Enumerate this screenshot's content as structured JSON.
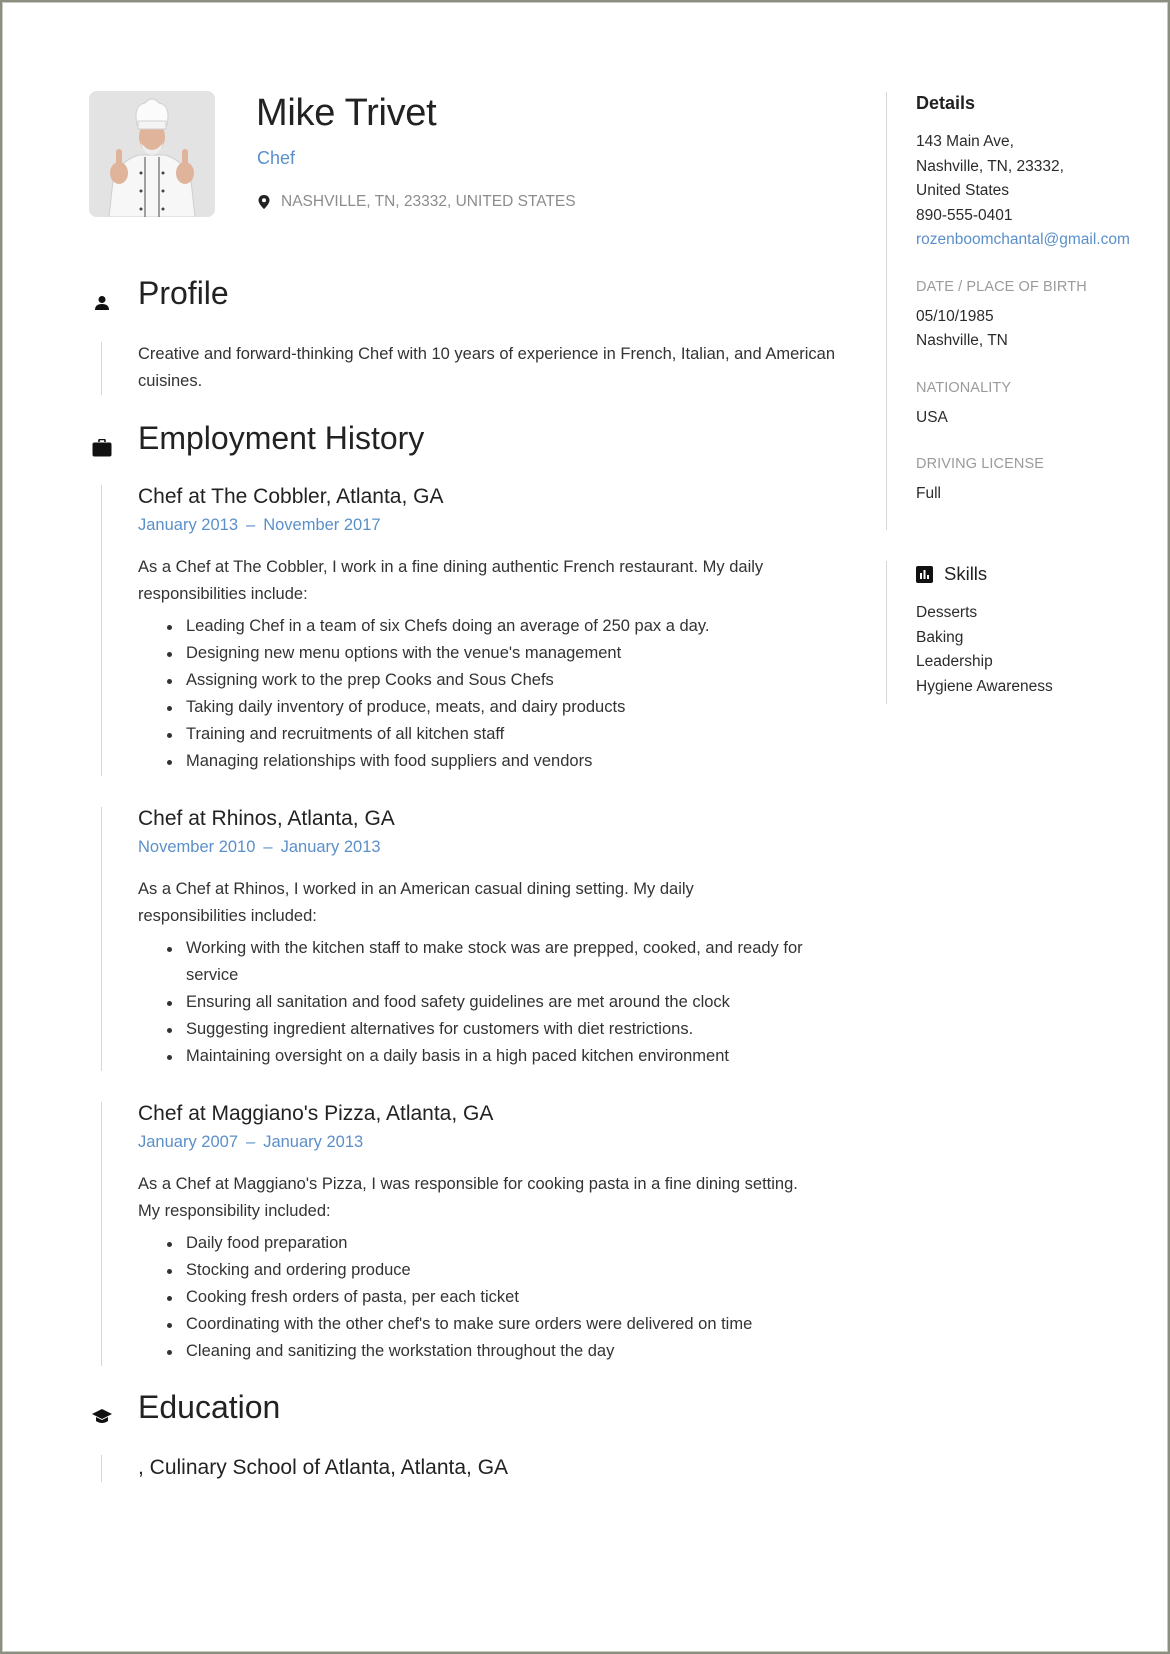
{
  "header": {
    "name": "Mike Trivet",
    "job_title": "Chef",
    "location": "NASHVILLE, TN, 23332, UNITED STATES",
    "photo_alt": "Chef portrait giving thumbs up"
  },
  "profile": {
    "heading": "Profile",
    "icon": "person-icon",
    "text": "Creative and forward-thinking Chef with 10 years of experience in French, Italian, and American cuisines."
  },
  "employment": {
    "heading": "Employment History",
    "icon": "briefcase-icon",
    "jobs": [
      {
        "title": "Chef at The Cobbler, Atlanta, GA",
        "start": "January 2013",
        "end": "November 2017",
        "dash": "–",
        "description": "As a Chef at The Cobbler, I work in a fine dining authentic French restaurant. My daily responsibilities include:",
        "bullets": [
          "Leading Chef in a team of six Chefs doing an average of 250 pax a day.",
          "Designing new menu options with the venue's management",
          "Assigning work to the prep Cooks and Sous Chefs",
          "Taking daily inventory of produce, meats, and dairy products",
          "Training and recruitments of all kitchen staff",
          "Managing relationships with food suppliers and vendors"
        ]
      },
      {
        "title": "Chef at Rhinos, Atlanta, GA",
        "start": "November 2010",
        "end": "January 2013",
        "dash": "–",
        "description": "As a Chef at Rhinos, I worked in an American casual dining setting. My daily responsibilities included:",
        "bullets": [
          "Working with the kitchen staff to make stock was are prepped, cooked, and ready for service",
          "Ensuring all sanitation and food safety guidelines are met around the clock",
          "Suggesting ingredient alternatives for customers with diet restrictions.",
          "Maintaining oversight on a daily basis in a high paced kitchen environment"
        ]
      },
      {
        "title": "Chef at Maggiano's Pizza, Atlanta, GA",
        "start": "January 2007",
        "end": "January 2013",
        "dash": "–",
        "description": "As a Chef at Maggiano's Pizza, I was responsible for cooking pasta in a fine dining setting. My responsibility included:",
        "bullets": [
          "Daily food preparation",
          "Stocking and ordering produce",
          "Cooking fresh orders of pasta, per each ticket",
          "Coordinating with the other chef's to make sure orders were delivered on time",
          "Cleaning and sanitizing the workstation throughout the day"
        ]
      }
    ]
  },
  "education": {
    "heading": "Education",
    "icon": "graduation-cap-icon",
    "entry": ", Culinary School of Atlanta, Atlanta, GA"
  },
  "details": {
    "heading": "Details",
    "address_lines": [
      "143 Main Ave,",
      "Nashville, TN, 23332,",
      "United States"
    ],
    "phone": "890-555-0401",
    "email": "rozenboomchantal@gmail.com",
    "birth_label": "DATE / PLACE OF BIRTH",
    "birth_date": "05/10/1985",
    "birth_place": "Nashville, TN",
    "nationality_label": "NATIONALITY",
    "nationality": "USA",
    "license_label": "DRIVING LICENSE",
    "license": "Full"
  },
  "skills": {
    "heading": "Skills",
    "icon": "bar-chart-icon",
    "items": [
      "Desserts",
      "Baking",
      "Leadership",
      "Hygiene Awareness"
    ]
  },
  "colors": {
    "accent": "#5b8fc9",
    "text": "#2b2b2b",
    "muted": "#9b9b9b",
    "rule": "#d6d6d6"
  }
}
